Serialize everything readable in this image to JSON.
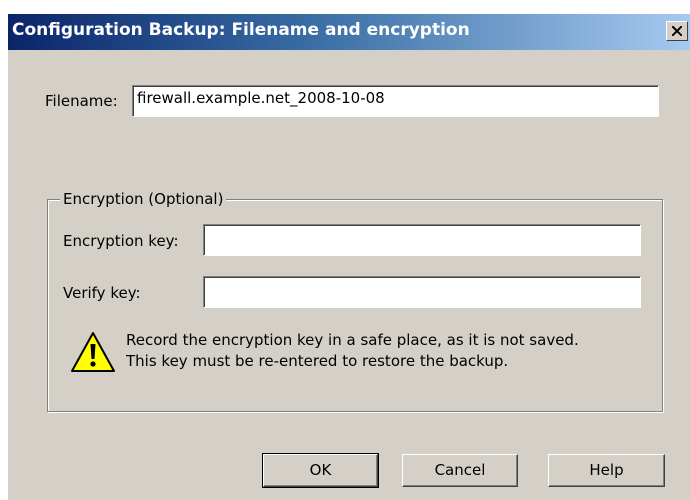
{
  "window": {
    "title": "Configuration Backup: Filename and encryption",
    "close_glyph": "X"
  },
  "filename": {
    "label": "Filename:",
    "value": "firewall.example.net_2008-10-08"
  },
  "encryption": {
    "group_label": "Encryption (Optional)",
    "key_label": "Encryption key:",
    "key_value": "",
    "verify_label": "Verify key:",
    "verify_value": "",
    "warning_icon": "warning-icon",
    "warning_line1": "Record the encryption key in a safe place, as it is not saved.",
    "warning_line2": "This key must be re-entered to restore the backup."
  },
  "buttons": {
    "ok": "OK",
    "cancel": "Cancel",
    "help": "Help"
  },
  "colors": {
    "dialog_bg": "#d4d0c8",
    "title_start": "#0a246a",
    "title_end": "#a6caf0",
    "warning_fill": "#ffff00"
  }
}
